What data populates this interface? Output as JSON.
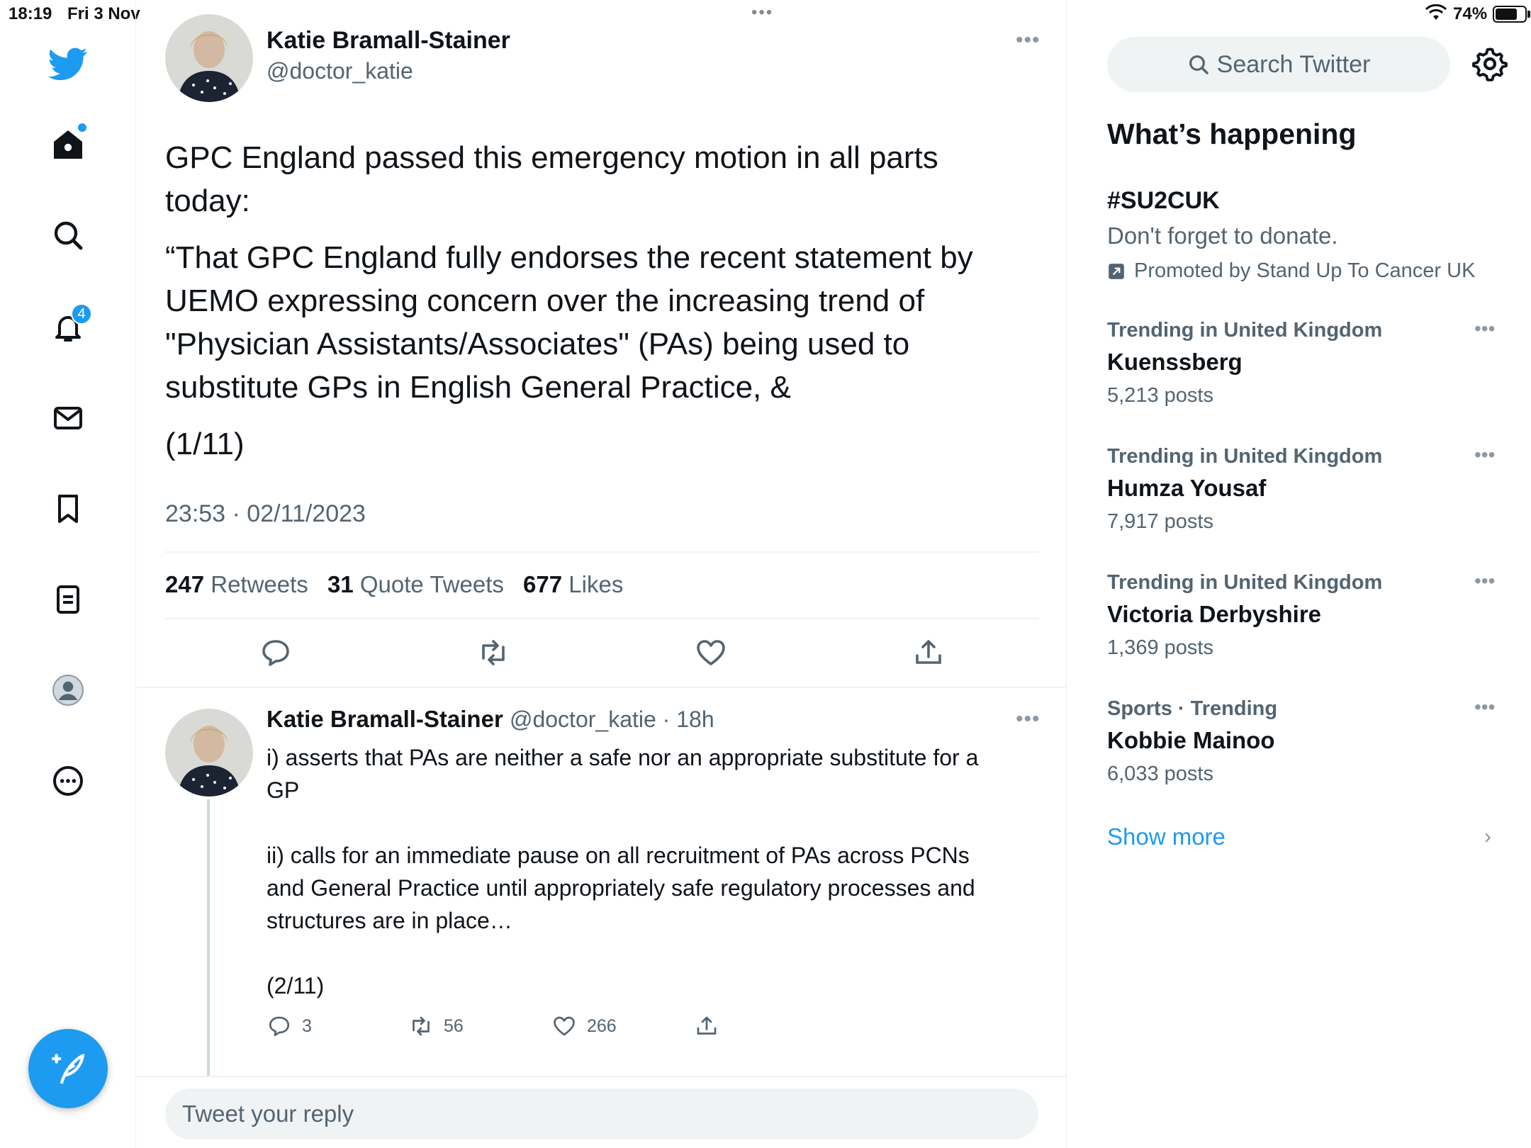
{
  "status": {
    "time": "18:19",
    "date": "Fri 3 Nov",
    "battery": "74%",
    "battery_level": 0.74
  },
  "nav": {
    "notifications_badge": "4"
  },
  "tweet": {
    "name": "Katie Bramall-Stainer",
    "handle": "@doctor_katie",
    "line1": "GPC England passed this emergency motion in all parts",
    "line2": "today:",
    "quote1": "“That GPC England fully endorses the recent statement by",
    "quote2": "UEMO expressing concern over the increasing trend of",
    "quote3": "\"Physician Assistants/Associates\" (PAs) being used to",
    "quote4": "substitute GPs in English General Practice, &",
    "counter": "(1/11)",
    "timestamp": "23:53 · 02/11/2023",
    "retweets": "247",
    "retweets_label": "Retweets",
    "quotes": "31",
    "quotes_label": "Quote Tweets",
    "likes": "677",
    "likes_label": "Likes"
  },
  "reply": {
    "name": "Katie Bramall-Stainer",
    "meta": "@doctor_katie · 18h",
    "p1a": "i) asserts that PAs are neither a safe nor an appropriate substitute for a",
    "p1b": "GP",
    "p2a": "ii) calls for an immediate pause on all recruitment of PAs across PCNs",
    "p2b": "and General Practice until appropriately safe regulatory processes and",
    "p2c": "structures are in place…",
    "counter": "(2/11)",
    "replies": "3",
    "retweets": "56",
    "likes": "266"
  },
  "reply_box": {
    "placeholder": "Tweet your reply"
  },
  "sidebar": {
    "search_placeholder": "Search Twitter",
    "title": "What’s happening",
    "promo": {
      "tag": "#SU2CUK",
      "desc": "Don't forget to donate.",
      "by": "Promoted by Stand Up To Cancer UK"
    },
    "trends": [
      {
        "category": "Trending in United Kingdom",
        "name": "Kuenssberg",
        "count": "5,213 posts"
      },
      {
        "category": "Trending in United Kingdom",
        "name": "Humza Yousaf",
        "count": "7,917 posts"
      },
      {
        "category": "Trending in United Kingdom",
        "name": "Victoria Derbyshire",
        "count": "1,369 posts"
      },
      {
        "category": "Sports · Trending",
        "name": "Kobbie Mainoo",
        "count": "6,033 posts"
      }
    ],
    "show_more": "Show more"
  },
  "colors": {
    "accent": "#1d9bf0",
    "muted": "#536471",
    "text": "#0f1419"
  }
}
